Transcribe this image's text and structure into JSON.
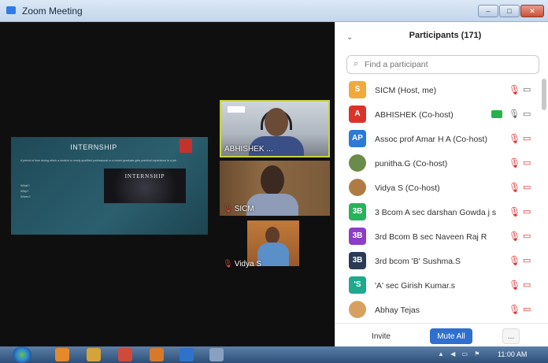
{
  "window": {
    "title": "Zoom Meeting"
  },
  "share": {
    "slide_title": "INTERNSHIP",
    "slide_text": "A period of time during which a student or newly qualified professional or a recent graduate gets practical experience in a job.",
    "bullets": [
      "What?",
      "Why?",
      "When?"
    ],
    "image_text": "INTERNSHIP"
  },
  "videos": [
    {
      "name": "ABHISHEK ..."
    },
    {
      "name": "SICM"
    },
    {
      "name": "Vidya S"
    }
  ],
  "participants_panel": {
    "title": "Participants (171)",
    "search_placeholder": "Find a participant",
    "participants": [
      {
        "name": "SICM (Host, me)",
        "avatar": "S",
        "color": "#f2a93b"
      },
      {
        "name": "ABHISHEK (Co-host)",
        "avatar": "A",
        "color": "#d9342b"
      },
      {
        "name": "Assoc prof Amar H A (Co-host)",
        "avatar": "AP",
        "color": "#2c7ad6"
      },
      {
        "name": "punitha.G (Co-host)",
        "avatar": "",
        "color": "#6a8c4a"
      },
      {
        "name": "Vidya S (Co-host)",
        "avatar": "",
        "color": "#b07a45"
      },
      {
        "name": "3 Bcom A sec darshan Gowda j s",
        "avatar": "3B",
        "color": "#27b35a"
      },
      {
        "name": "3rd Bcom B sec Naveen Raj R",
        "avatar": "3B",
        "color": "#8b3fc4"
      },
      {
        "name": "3rd bcom 'B' Sushma.S",
        "avatar": "3B",
        "color": "#2b3b55"
      },
      {
        "name": "'A' sec Girish Kumar.s",
        "avatar": "'S",
        "color": "#1fa98c"
      },
      {
        "name": "Abhay Tejas",
        "avatar": "",
        "color": "#d8a060"
      }
    ],
    "footer": {
      "invite": "Invite",
      "mute_all": "Mute All",
      "more": "..."
    }
  },
  "taskbar": {
    "clock": "11:00 AM"
  }
}
